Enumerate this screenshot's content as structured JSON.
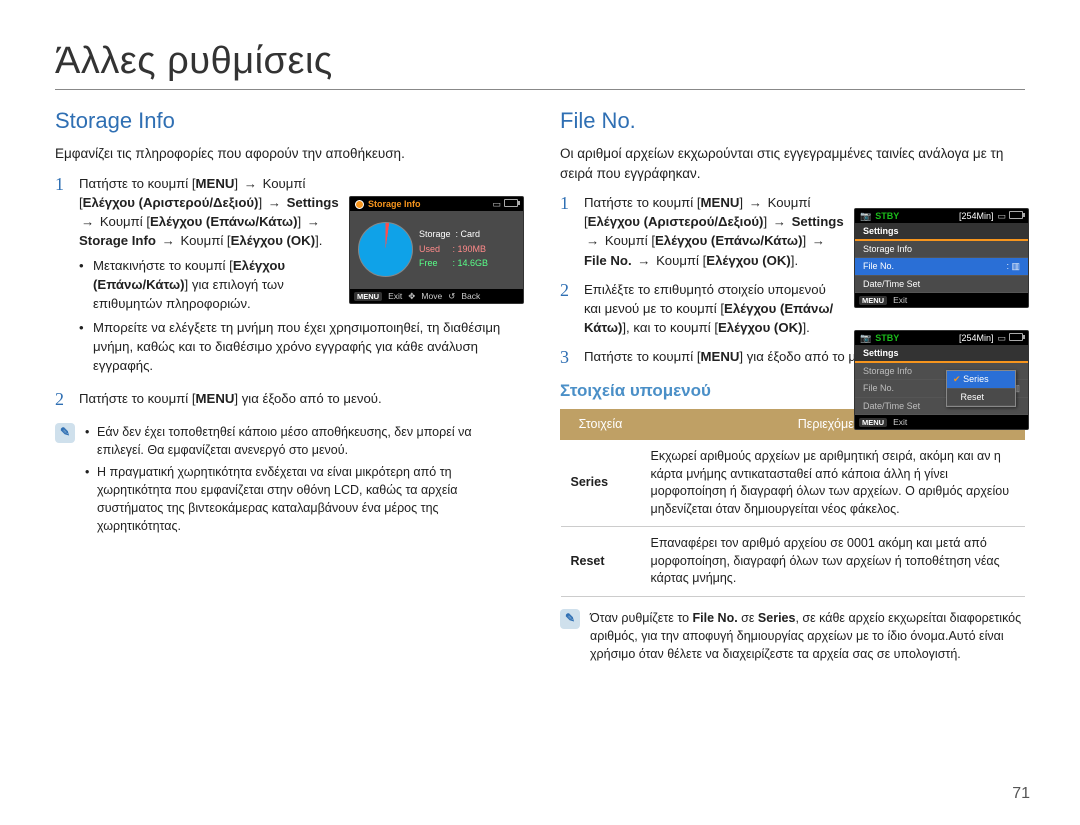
{
  "page_title": "Άλλες ρυθμίσεις",
  "page_number": "71",
  "left": {
    "heading": "Storage Info",
    "intro": "Εμφανίζει τις πληροφορίες που αφορούν την αποθήκευση.",
    "step1": {
      "text_pre": "Πατήστε το κουμπί [",
      "menu": "MENU",
      "text_1": "] ",
      "arrow": "→",
      "btn1": " Κουμπί [",
      "b1": "Ελέγχου (Αριστερού/Δεξιού)",
      "t2": "] ",
      "b2": "Settings",
      "t3": " Κουμπί [",
      "b3": "Ελέγχου (Επάνω/Κάτω)",
      "t4": "] ",
      "b4": "Storage Info",
      "t5": " Κουμπί [",
      "b5": "Ελέγχου (OK)",
      "t6": "].",
      "bullet1a": "Μετακινήστε το κουμπί [",
      "bullet1b": "Ελέγχου (Επάνω/Κάτω)",
      "bullet1c": "] για επιλογή των επιθυμητών πληροφοριών.",
      "bullet2": "Μπορείτε να ελέγξετε τη μνήμη που έχει χρησιμοποιηθεί, τη διαθέσιμη μνήμη, καθώς και το διαθέσιμο χρόνο εγγραφής για κάθε ανάλυση εγγραφής."
    },
    "step2": {
      "text_a": "Πατήστε το κουμπί [",
      "menu": "MENU",
      "text_b": "] για έξοδο από το μενού."
    },
    "note": {
      "b1": "Εάν δεν έχει τοποθετηθεί κάποιο μέσο αποθήκευσης, δεν μπορεί να επιλεγεί. Θα εμφανίζεται ανενεργό στο μενού.",
      "b2": "Η πραγματική χωρητικότητα ενδέχεται να είναι μικρότερη από τη χωρητικότητα που εμφανίζεται στην οθόνη LCD, καθώς τα αρχεία συστήματος της βιντεοκάμερας καταλαμβάνουν ένα μέρος της χωρητικότητας."
    },
    "ui": {
      "title": "Storage Info",
      "storage_k": "Storage",
      "storage_v": ": Card",
      "used_k": "Used",
      "used_v": ": 190MB",
      "free_k": "Free",
      "free_v": ": 14.6GB",
      "menu": "MENU",
      "exit": "Exit",
      "move": "Move",
      "back": "Back"
    }
  },
  "right": {
    "heading": "File No.",
    "intro": "Οι αριθμοί αρχείων εκχωρούνται στις εγγεγραμμένες ταινίες ανάλογα με τη σειρά που εγγράφηκαν.",
    "step1": {
      "pre": "Πατήστε το κουμπί [",
      "menu": "MENU",
      "t1": "] ",
      "arrow": "→",
      "t2": " Κουμπί [",
      "b1": "Ελέγχου (Αριστερού/Δεξιού)",
      "t3": "] ",
      "b2": "Settings",
      "t4": " Κουμπί [",
      "b3": "Ελέγχου (Επάνω/Κάτω)",
      "t5": "] ",
      "b4": "File No.",
      "t6": " ",
      "t7": " Κουμπί [",
      "b5": "Ελέγχου (OK)",
      "t8": "]."
    },
    "step2": {
      "t1": "Επιλέξτε το επιθυμητό στοιχείο υπομενού και μενού με το κουμπί [",
      "b1": "Ελέγχου (Επάνω/Κάτω)",
      "t2": "], και το κουμπί [",
      "b2": "Ελέγχου (OK)",
      "t3": "]."
    },
    "step3": {
      "t1": "Πατήστε το κουμπί [",
      "menu": "MENU",
      "t2": "] για έξοδο από το μενού."
    },
    "ui1": {
      "stby": "STBY",
      "time": "[254Min]",
      "settings": "Settings",
      "row1": "Storage Info",
      "row2": "File No.",
      "row2v": ":",
      "row3": "Date/Time Set",
      "menu": "MENU",
      "exit": "Exit"
    },
    "ui2": {
      "stby": "STBY",
      "time": "[254Min]",
      "settings": "Settings",
      "row1": "Storage Info",
      "row2": "File No.",
      "row3": "Date/Time Set",
      "pop1": "Series",
      "pop2": "Reset",
      "menu": "MENU",
      "exit": "Exit"
    },
    "submenu_heading": "Στοιχεία υπομενού",
    "table": {
      "h1": "Στοιχεία",
      "h2": "Περιεχόμενα",
      "r1k": "Series",
      "r1v": "Εκχωρεί αριθμούς αρχείων με αριθμητική σειρά, ακόμη και αν η κάρτα μνήμης αντικατασταθεί από κάποια άλλη ή γίνει μορφοποίηση ή διαγραφή όλων των αρχείων. Ο αριθμός αρχείου μηδενίζεται όταν δημιουργείται νέος φάκελος.",
      "r2k": "Reset",
      "r2v": "Επαναφέρει τον αριθμό αρχείου σε 0001 ακόμη και μετά από μορφοποίηση, διαγραφή όλων των αρχείων ή τοποθέτηση νέας κάρτας μνήμης."
    },
    "note": {
      "t1": "Όταν ρυθμίζετε το ",
      "b1": "File No.",
      "t2": " σε ",
      "b2": "Series",
      "t3": ", σε κάθε αρχείο εκχωρείται διαφορετικός αριθμός, για την αποφυγή δημιουργίας αρχείων με το ίδιο όνομα.Αυτό είναι χρήσιμο όταν θέλετε να διαχειρίζεστε τα αρχεία σας σε υπολογιστή."
    }
  }
}
